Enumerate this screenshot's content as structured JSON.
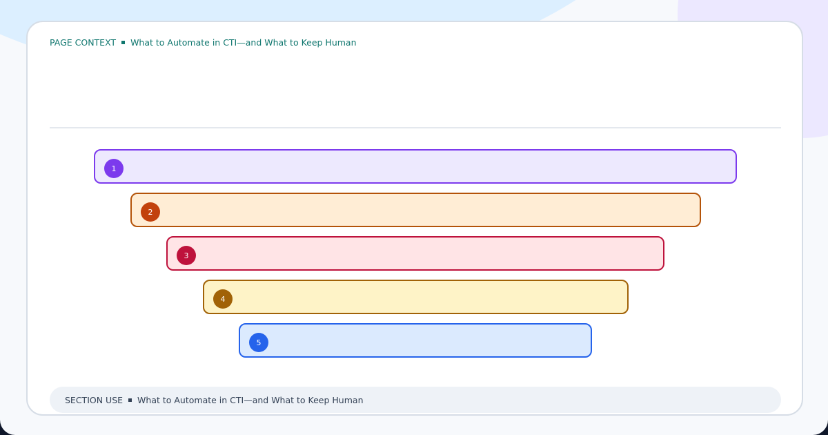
{
  "context": {
    "label": "PAGE CONTEXT",
    "title": "What to Automate in CTI—and What to Keep Human"
  },
  "stages": [
    {
      "number": "1",
      "color": "#7c3aed"
    },
    {
      "number": "2",
      "color": "#c2410c"
    },
    {
      "number": "3",
      "color": "#be123c"
    },
    {
      "number": "4",
      "color": "#a16207"
    },
    {
      "number": "5",
      "color": "#2563eb"
    }
  ],
  "section_use": {
    "label": "SECTION USE",
    "title": "What to Automate in CTI—and What to Keep Human"
  }
}
